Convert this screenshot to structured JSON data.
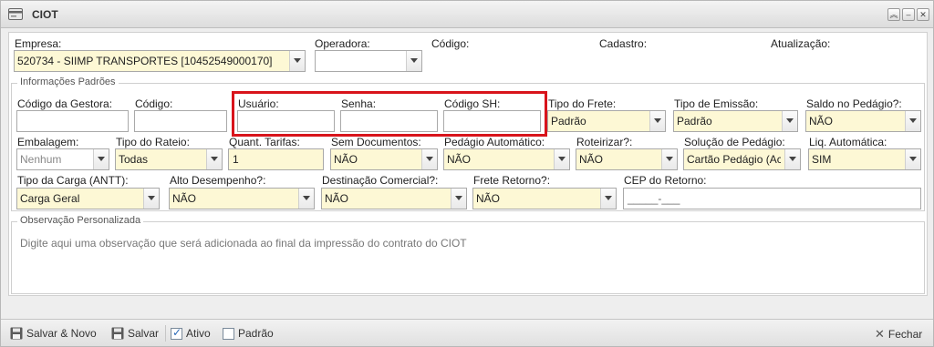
{
  "window": {
    "title": "CIOT"
  },
  "header": {
    "empresa_label": "Empresa:",
    "empresa_value": "520734 - SIIMP TRANSPORTES [10452549000170]",
    "operadora_label": "Operadora:",
    "operadora_value": "",
    "codigo_label": "Código:",
    "cadastro_label": "Cadastro:",
    "atualizacao_label": "Atualização:"
  },
  "padroes": {
    "legend": "Informações Padrões",
    "codigo_gestora_label": "Código da Gestora:",
    "codigo_label": "Código:",
    "usuario_label": "Usuário:",
    "senha_label": "Senha:",
    "codigo_sh_label": "Código SH:",
    "tipo_frete_label": "Tipo do Frete:",
    "tipo_frete_value": "Padrão",
    "tipo_emissao_label": "Tipo de Emissão:",
    "tipo_emissao_value": "Padrão",
    "saldo_pedagio_label": "Saldo no Pedágio?:",
    "saldo_pedagio_value": "NÃO",
    "embalagem_label": "Embalagem:",
    "embalagem_value": "Nenhum",
    "tipo_rateio_label": "Tipo do Rateio:",
    "tipo_rateio_value": "Todas",
    "quant_tarifas_label": "Quant. Tarifas:",
    "quant_tarifas_value": "1",
    "sem_documentos_label": "Sem Documentos:",
    "sem_documentos_value": "NÃO",
    "pedagio_automatico_label": "Pedágio Automático:",
    "pedagio_automatico_value": "NÃO",
    "roteirizar_label": "Roteirizar?:",
    "roteirizar_value": "NÃO",
    "solucao_pedagio_label": "Solução de Pedágio:",
    "solucao_pedagio_value": "Cartão Pedágio (Ac",
    "liq_automatica_label": "Liq. Automática:",
    "liq_automatica_value": "SIM",
    "tipo_carga_label": "Tipo da Carga (ANTT):",
    "tipo_carga_value": "Carga Geral",
    "alto_desempenho_label": "Alto Desempenho?:",
    "alto_desempenho_value": "NÃO",
    "destinacao_comercial_label": "Destinação Comercial?:",
    "destinacao_comercial_value": "NÃO",
    "frete_retorno_label": "Frete Retorno?:",
    "frete_retorno_value": "NÃO",
    "cep_retorno_label": "CEP do Retorno:",
    "cep_retorno_placeholder": "_____-___"
  },
  "observacao": {
    "legend": "Observação Personalizada",
    "placeholder": "Digite aqui uma observação que será adicionada ao final da impressão do contrato do CIOT"
  },
  "toolbar": {
    "salvar_novo_label": "Salvar & Novo",
    "salvar_label": "Salvar",
    "ativo_label": "Ativo",
    "ativo_checked": true,
    "padrao_label": "Padrão",
    "padrao_checked": false,
    "fechar_label": "Fechar"
  },
  "colors": {
    "highlight": "#d8141b",
    "select_bg": "#fdf8d5"
  }
}
